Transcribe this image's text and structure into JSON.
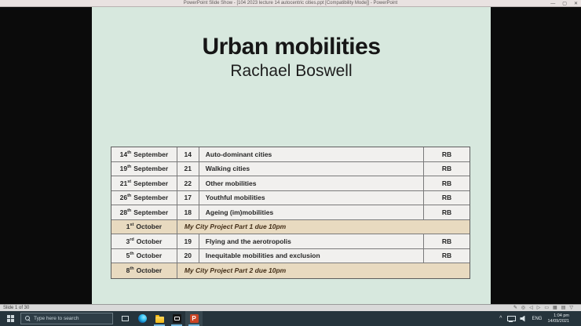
{
  "window": {
    "title": "PowerPoint Slide Show - [104 2023 lecture 14 autocentric cities.ppt [Compatibility Mode]] - PowerPoint",
    "controls": {
      "minimize": "—",
      "maximize": "▢",
      "close": "✕"
    }
  },
  "slide": {
    "title": "Urban mobilities",
    "subtitle": "Rachael Boswell",
    "background_color": "#d7e8de",
    "highlight_color": "#e8dac0",
    "table": {
      "rows": [
        {
          "day": "14",
          "ordinal": "th",
          "month": "September",
          "num": "14",
          "topic": "Auto-dominant cities",
          "presenter": "RB"
        },
        {
          "day": "19",
          "ordinal": "th",
          "month": "September",
          "num": "21",
          "topic": "Walking cities",
          "presenter": "RB"
        },
        {
          "day": "21",
          "ordinal": "st",
          "month": "September",
          "num": "22",
          "topic": "Other mobilities",
          "presenter": "RB"
        },
        {
          "day": "26",
          "ordinal": "th",
          "month": "September",
          "num": "17",
          "topic": "Youthful mobilities",
          "presenter": "RB"
        },
        {
          "day": "28",
          "ordinal": "th",
          "month": "September",
          "num": "18",
          "topic": "Ageing (im)mobilities",
          "presenter": "RB"
        },
        {
          "day": "1",
          "ordinal": "st",
          "month": "October",
          "note": "My City Project Part 1 due 10pm"
        },
        {
          "day": "3",
          "ordinal": "rd",
          "month": "October",
          "num": "19",
          "topic": "Flying and the aerotropolis",
          "presenter": "RB"
        },
        {
          "day": "5",
          "ordinal": "th",
          "month": "October",
          "num": "20",
          "topic": "Inequitable mobilities and exclusion",
          "presenter": "RB"
        },
        {
          "day": "8",
          "ordinal": "th",
          "month": "October",
          "note": "My City Project Part 2 due 10pm"
        }
      ]
    }
  },
  "statusbar": {
    "slide_indicator": "Slide 1 of 30",
    "icons": [
      {
        "name": "pen-icon",
        "glyph": "✎"
      },
      {
        "name": "annotations-menu-icon",
        "glyph": "◎"
      },
      {
        "name": "previous-slide-icon",
        "glyph": "◁"
      },
      {
        "name": "next-slide-icon",
        "glyph": "▷"
      },
      {
        "name": "normal-view-icon",
        "glyph": "▭"
      },
      {
        "name": "slide-sorter-icon",
        "glyph": "▦"
      },
      {
        "name": "reading-view-icon",
        "glyph": "▤"
      },
      {
        "name": "zoom-chevron-icon",
        "glyph": "▽"
      }
    ]
  },
  "taskbar": {
    "search_placeholder": "Type here to search",
    "powerpoint_initial": "P",
    "tray": {
      "language": "ENG",
      "time": "1:04 pm",
      "date": "14/09/2021",
      "chevron": "^"
    }
  }
}
